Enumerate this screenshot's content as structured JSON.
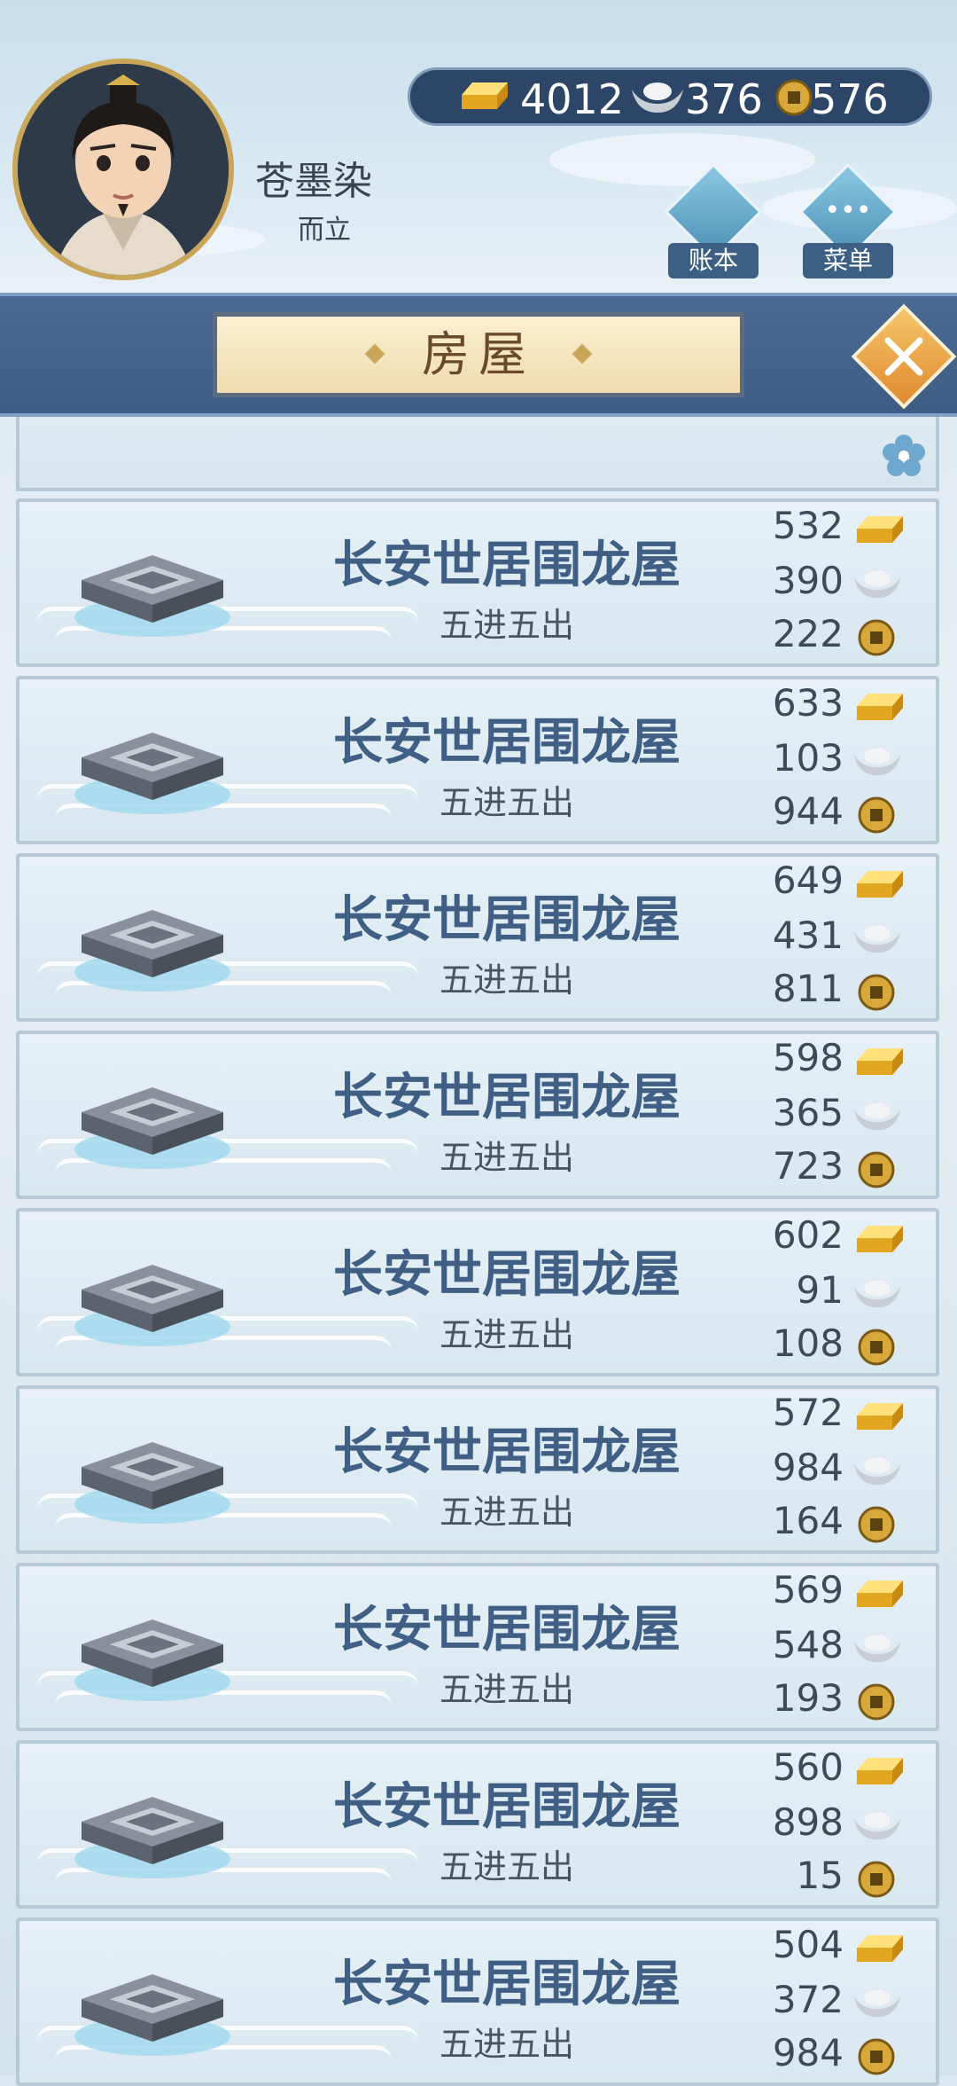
{
  "player": {
    "name": "苍墨染",
    "title": "而立"
  },
  "currency": {
    "gold": "4012",
    "silver": "376",
    "coin": "576"
  },
  "top_buttons": {
    "ledger_label": "账本",
    "menu_label": "菜单"
  },
  "panel": {
    "title": "房屋"
  },
  "houses": [
    {
      "name": "长安世居围龙屋",
      "desc": "五进五出",
      "gold": "532",
      "silver": "390",
      "coin": "222"
    },
    {
      "name": "长安世居围龙屋",
      "desc": "五进五出",
      "gold": "633",
      "silver": "103",
      "coin": "944"
    },
    {
      "name": "长安世居围龙屋",
      "desc": "五进五出",
      "gold": "649",
      "silver": "431",
      "coin": "811"
    },
    {
      "name": "长安世居围龙屋",
      "desc": "五进五出",
      "gold": "598",
      "silver": "365",
      "coin": "723"
    },
    {
      "name": "长安世居围龙屋",
      "desc": "五进五出",
      "gold": "602",
      "silver": "91",
      "coin": "108"
    },
    {
      "name": "长安世居围龙屋",
      "desc": "五进五出",
      "gold": "572",
      "silver": "984",
      "coin": "164"
    },
    {
      "name": "长安世居围龙屋",
      "desc": "五进五出",
      "gold": "569",
      "silver": "548",
      "coin": "193"
    },
    {
      "name": "长安世居围龙屋",
      "desc": "五进五出",
      "gold": "560",
      "silver": "898",
      "coin": "15"
    },
    {
      "name": "长安世居围龙屋",
      "desc": "五进五出",
      "gold": "504",
      "silver": "372",
      "coin": "984"
    }
  ],
  "icons": {
    "gold": "gold-ingot-icon",
    "silver": "silver-ingot-icon",
    "coin": "copper-coin-icon",
    "ledger": "ledger-icon",
    "menu": "more-dots-icon",
    "close": "close-icon"
  },
  "colors": {
    "header": "#3d5c86",
    "title_text": "#6b4a2b",
    "house_name": "#3f5f85"
  }
}
